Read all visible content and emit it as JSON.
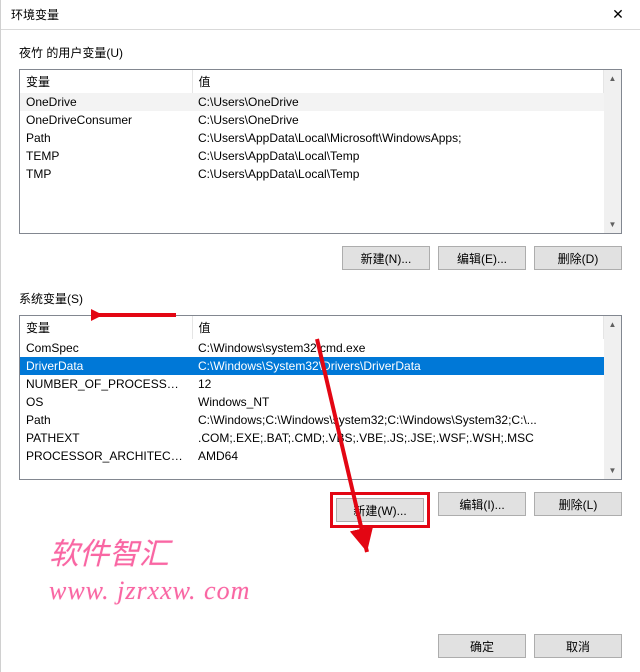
{
  "title": "环境变量",
  "user_section": {
    "label": "夜竹 的用户变量(U)",
    "columns": [
      "变量",
      "值"
    ],
    "rows": [
      {
        "name": "OneDrive",
        "value": "C:\\Users\\OneDrive",
        "hl": true
      },
      {
        "name": "OneDriveConsumer",
        "value": "C:\\Users\\OneDrive"
      },
      {
        "name": "Path",
        "value": "C:\\Users\\AppData\\Local\\Microsoft\\WindowsApps;"
      },
      {
        "name": "TEMP",
        "value": "C:\\Users\\AppData\\Local\\Temp"
      },
      {
        "name": "TMP",
        "value": "C:\\Users\\AppData\\Local\\Temp"
      }
    ],
    "buttons": {
      "new": "新建(N)...",
      "edit": "编辑(E)...",
      "delete": "删除(D)"
    }
  },
  "system_section": {
    "label": "系统变量(S)",
    "columns": [
      "变量",
      "值"
    ],
    "rows": [
      {
        "name": "ComSpec",
        "value": "C:\\Windows\\system32\\cmd.exe"
      },
      {
        "name": "DriverData",
        "value": "C:\\Windows\\System32\\Drivers\\DriverData",
        "selected": true
      },
      {
        "name": "NUMBER_OF_PROCESSORS",
        "value": "12"
      },
      {
        "name": "OS",
        "value": "Windows_NT"
      },
      {
        "name": "Path",
        "value": "C:\\Windows;C:\\Windows\\system32;C:\\Windows\\System32;C:\\..."
      },
      {
        "name": "PATHEXT",
        "value": ".COM;.EXE;.BAT;.CMD;.VBS;.VBE;.JS;.JSE;.WSF;.WSH;.MSC"
      },
      {
        "name": "PROCESSOR_ARCHITECT...",
        "value": "AMD64"
      }
    ],
    "buttons": {
      "new": "新建(W)...",
      "edit": "编辑(I)...",
      "delete": "删除(L)"
    }
  },
  "footer": {
    "ok": "确定",
    "cancel": "取消"
  },
  "watermark": {
    "line1": "软件智汇",
    "line2": "www. jzrxxw. com"
  },
  "colors": {
    "accent": "#0078d7",
    "annotation": "#e30613",
    "watermark": "#f966a3"
  }
}
